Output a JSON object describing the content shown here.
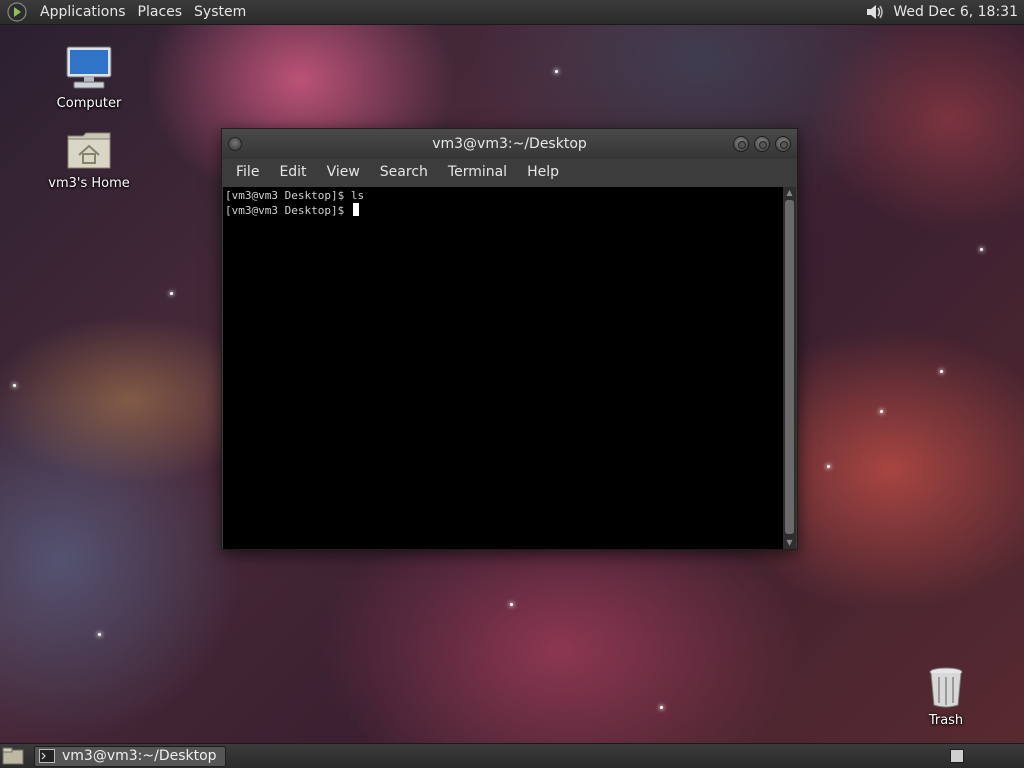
{
  "top_panel": {
    "menus": [
      "Applications",
      "Places",
      "System"
    ],
    "clock": "Wed Dec  6, 18:31",
    "icons": {
      "menu_logo": "gnome-foot-icon",
      "volume": "speaker-icon"
    }
  },
  "desktop": {
    "icons": [
      {
        "label": "Computer",
        "icon": "computer-icon"
      },
      {
        "label": "vm3's Home",
        "icon": "home-folder-icon"
      },
      {
        "label": "Trash",
        "icon": "trash-icon"
      }
    ]
  },
  "terminal": {
    "title": "vm3@vm3:~/Desktop",
    "menus": [
      "File",
      "Edit",
      "View",
      "Search",
      "Terminal",
      "Help"
    ],
    "lines": [
      "[vm3@vm3 Desktop]$ ls",
      "[vm3@vm3 Desktop]$ "
    ]
  },
  "bottom_panel": {
    "task": "vm3@vm3:~/Desktop",
    "icons": {
      "show_desktop": "show-desktop-icon",
      "task": "terminal-icon"
    }
  },
  "colors": {
    "panel": "#2b2b2b",
    "terminal_bg": "#000000",
    "terminal_fg": "#d0d0d0"
  }
}
